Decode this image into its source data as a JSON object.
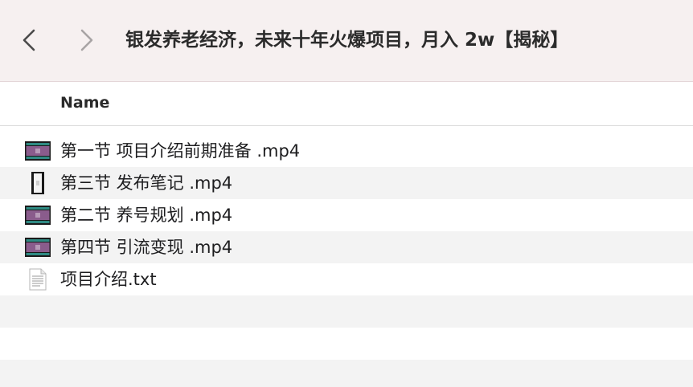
{
  "toolbar": {
    "back_icon": "chevron-left-icon",
    "forward_icon": "chevron-right-icon",
    "title": "银发养老经济，未来十年火爆项目，月入 2w【揭秘】"
  },
  "columns": {
    "name": "Name"
  },
  "files": [
    {
      "name": "第一节 项目介绍前期准备 .mp4",
      "icon": "video-thumbnail-icon"
    },
    {
      "name": "第三节 发布笔记 .mp4",
      "icon": "video-portrait-thumbnail-icon"
    },
    {
      "name": "第二节 养号规划 .mp4",
      "icon": "video-thumbnail-icon"
    },
    {
      "name": "第四节 引流变现 .mp4",
      "icon": "video-thumbnail-icon"
    },
    {
      "name": "项目介绍.txt",
      "icon": "text-document-icon"
    }
  ],
  "colors": {
    "toolbar_bg": "#f6f0f0",
    "alt_row_bg": "#f3f3f3",
    "thumb_purple": "#8a5c8c",
    "thumb_teal": "#2f8a83"
  }
}
